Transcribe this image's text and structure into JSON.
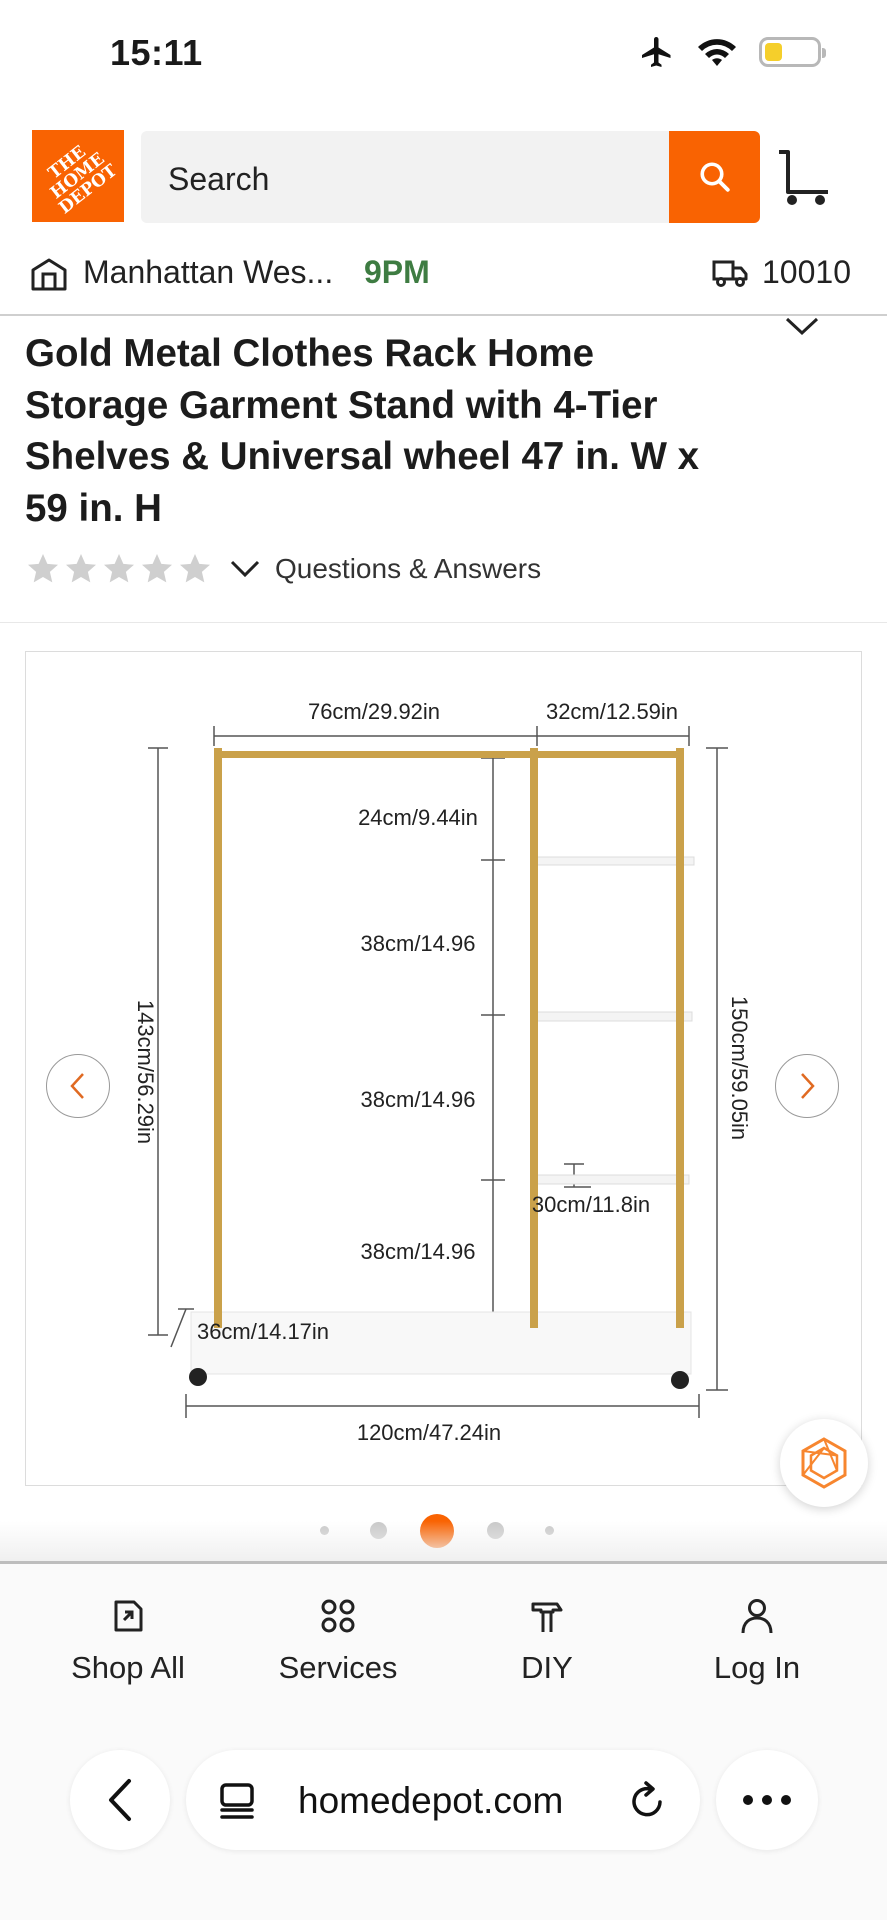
{
  "status_bar": {
    "time": "15:11",
    "battery_level": 0.3,
    "battery_color": "#f5cf2b"
  },
  "header": {
    "logo_text": "THE\nHOME\nDEPOT",
    "search_placeholder": "Search",
    "accent_color": "#f96302"
  },
  "store": {
    "name": "Manhattan Wes...",
    "closing_time": "9PM",
    "zip": "10010"
  },
  "product": {
    "title": "Gold Metal Clothes Rack Home Storage Garment Stand with 4-Tier Shelves & Universal wheel 47 in. W x 59 in. H",
    "rating_stars": 0,
    "rating_max": 5,
    "qa_label": "Questions & Answers"
  },
  "image": {
    "dimensions": {
      "top_left": "76cm/29.92in",
      "top_right": "32cm/12.59in",
      "upper_gap": "24cm/9.44in",
      "gap_1": "38cm/14.96",
      "gap_2": "38cm/14.96",
      "gap_3": "38cm/14.96",
      "shelf_depth": "30cm/11.8in",
      "base_depth": "36cm/14.17in",
      "width_total": "120cm/47.24in",
      "height_left": "143cm/56.29in",
      "height_right": "150cm/59.05in"
    },
    "carousel_index": 3,
    "carousel_count": 5
  },
  "bottom_nav": {
    "tabs": [
      {
        "label": "Shop All",
        "icon": "shop-all-icon"
      },
      {
        "label": "Services",
        "icon": "services-icon"
      },
      {
        "label": "DIY",
        "icon": "diy-icon"
      },
      {
        "label": "Log In",
        "icon": "person-icon"
      }
    ]
  },
  "browser": {
    "url": "homedepot.com"
  }
}
